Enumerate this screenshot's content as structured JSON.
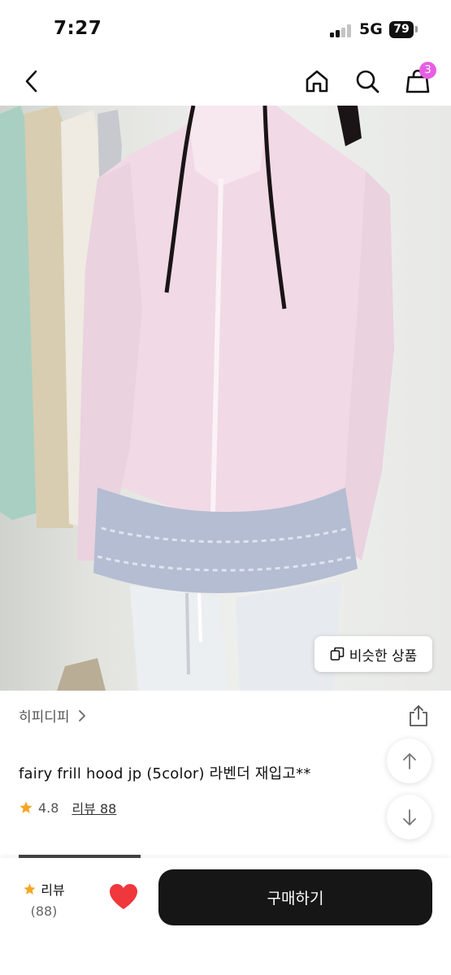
{
  "status_bar": {
    "time": "7:27",
    "network": "5G",
    "battery": "79"
  },
  "nav": {
    "cart_badge": "3"
  },
  "product": {
    "similar_button_label": "비슷한 상품",
    "shop_name": "히피디피",
    "title": "fairy frill hood jp (5color) 라벤더 재입고**",
    "rating": "4.8",
    "review_link": "리뷰 88"
  },
  "bottom_bar": {
    "review_label": "리뷰",
    "review_count": "(88)",
    "buy_label": "구매하기"
  },
  "colors": {
    "badge": "#e65fe3",
    "star": "#f5a623",
    "heart": "#f0373c",
    "buy_button": "#161616"
  }
}
